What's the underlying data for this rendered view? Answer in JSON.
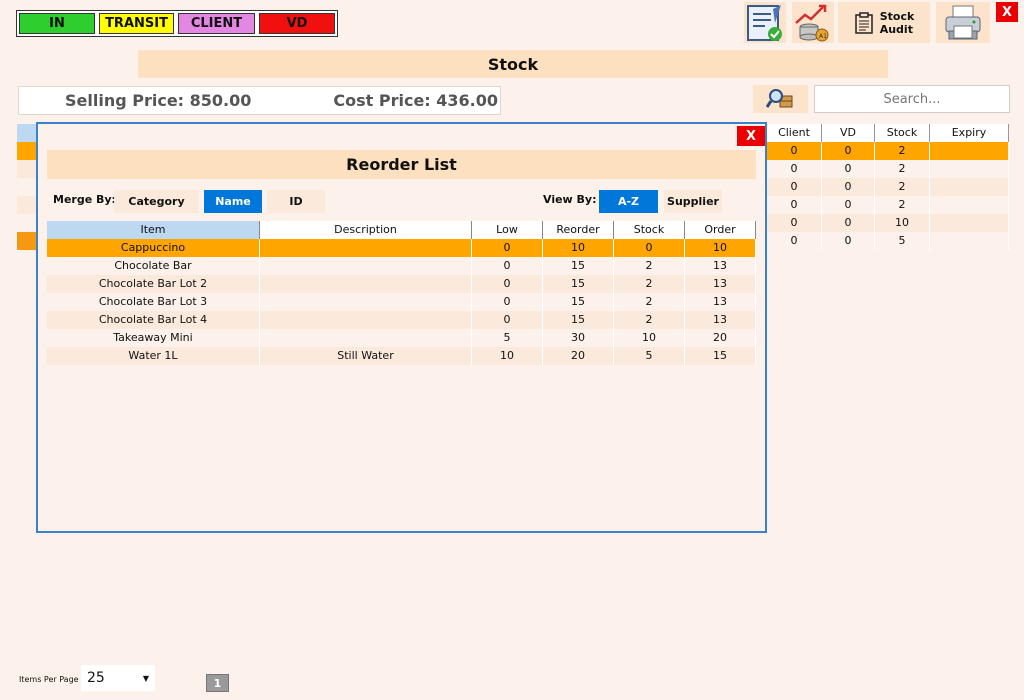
{
  "legend": [
    {
      "label": "IN",
      "color": "#2ece2e"
    },
    {
      "label": "TRANSIT",
      "color": "#ffff00"
    },
    {
      "label": "CLIENT",
      "color": "#e387e3"
    },
    {
      "label": "VD",
      "color": "#f01010"
    }
  ],
  "toolbar": {
    "stock_audit_label_1": "Stock",
    "stock_audit_label_2": "Audit",
    "close_label": "X"
  },
  "header": {
    "title": "Stock",
    "selling_price": "Selling Price: 850.00",
    "cost_price": "Cost Price: 436.00",
    "search_placeholder": "Search..."
  },
  "bg_table": {
    "columns": [
      "Client",
      "VD",
      "Stock",
      "Expiry"
    ],
    "rows": [
      [
        "0",
        "0",
        "2",
        ""
      ],
      [
        "0",
        "0",
        "2",
        ""
      ],
      [
        "0",
        "0",
        "2",
        ""
      ],
      [
        "0",
        "0",
        "2",
        ""
      ],
      [
        "0",
        "0",
        "10",
        ""
      ],
      [
        "0",
        "0",
        "5",
        ""
      ]
    ]
  },
  "modal": {
    "close_label": "X",
    "title": "Reorder List",
    "merge_by_label": "Merge By:",
    "merge_options": [
      "Category",
      "Name",
      "ID"
    ],
    "view_by_label": "View By:",
    "view_options": [
      "A-Z",
      "Supplier"
    ],
    "columns": [
      "Item",
      "Description",
      "Low",
      "Reorder",
      "Stock",
      "Order"
    ],
    "rows": [
      [
        "Cappuccino",
        "",
        "0",
        "10",
        "0",
        "10"
      ],
      [
        "Chocolate Bar",
        "",
        "0",
        "15",
        "2",
        "13"
      ],
      [
        "Chocolate Bar Lot 2",
        "",
        "0",
        "15",
        "2",
        "13"
      ],
      [
        "Chocolate Bar Lot 3",
        "",
        "0",
        "15",
        "2",
        "13"
      ],
      [
        "Chocolate Bar Lot 4",
        "",
        "0",
        "15",
        "2",
        "13"
      ],
      [
        "Takeaway Mini",
        "",
        "5",
        "30",
        "10",
        "20"
      ],
      [
        "Water 1L",
        "Still Water",
        "10",
        "20",
        "5",
        "15"
      ]
    ]
  },
  "footer": {
    "items_per_page_label": "Items Per Page",
    "items_per_page_value": "25",
    "page": "1"
  },
  "colors": {
    "accent": "#0077d9",
    "selected_row": "#ffa500",
    "close": "#ea0000"
  }
}
